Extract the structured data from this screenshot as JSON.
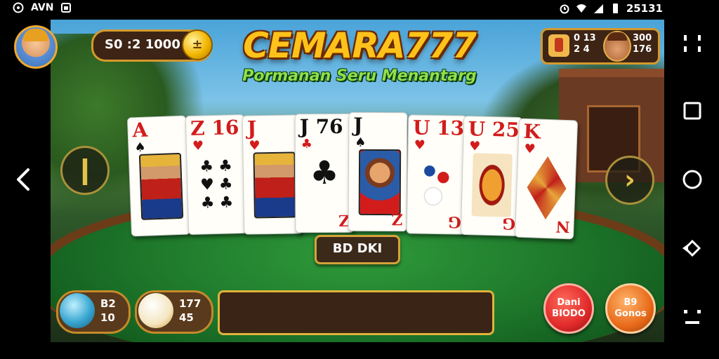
{
  "status_bar": {
    "left_text": "AVN",
    "time": "25131"
  },
  "game": {
    "title": "CEMARA777",
    "subtitle": "Pormanan Seru Menantarg",
    "balance": "S0 :2 1000",
    "coin_symbol": "±",
    "opponent": {
      "badge_stat_top": "0 13",
      "badge_stat_bottom": "2 4",
      "score_top": "300",
      "score_bottom": "176"
    },
    "nav_arrows": {
      "left": "❙",
      "right": "›"
    },
    "cards": [
      {
        "rank": "A",
        "suit": "♠",
        "color": "red",
        "suit_color": "blk",
        "corner": "",
        "art": "king"
      },
      {
        "rank": "Z 16",
        "suit": "♥",
        "color": "red",
        "suit_color": "red",
        "corner": "",
        "art": "clubs"
      },
      {
        "rank": "J",
        "suit": "♥",
        "color": "red",
        "suit_color": "red",
        "corner": "",
        "art": "king"
      },
      {
        "rank": "J 76",
        "suit": "♣",
        "color": "blk",
        "suit_color": "red",
        "corner": "Z",
        "art": "club"
      },
      {
        "rank": "J",
        "suit": "♠",
        "color": "blk",
        "suit_color": "blk",
        "corner": "Z",
        "art": "face"
      },
      {
        "rank": "U 13",
        "suit": "♥",
        "color": "red",
        "suit_color": "red",
        "corner": "G",
        "art": "dots"
      },
      {
        "rank": "U 25",
        "suit": "♥",
        "color": "red",
        "suit_color": "red",
        "corner": "G",
        "art": "shield"
      },
      {
        "rank": "K",
        "suit": "♥",
        "color": "red",
        "suit_color": "red",
        "corner": "N",
        "art": "diamond"
      }
    ],
    "deal_button": "BD DKI",
    "chip_left": {
      "line1": "B2",
      "line2": "10"
    },
    "chip_mid": {
      "line1": "177",
      "line2": "45"
    },
    "btn_red": "Dani\nBIODO",
    "btn_orange": "B9\nGonos"
  },
  "colors": {
    "title_gold": "#ffc21a",
    "subtitle_green": "#8ee04a",
    "felt_green": "#1f7a2c",
    "panel_border": "#d59a2d",
    "btn_red": "#e02a2a",
    "btn_orange": "#e86a1a"
  }
}
